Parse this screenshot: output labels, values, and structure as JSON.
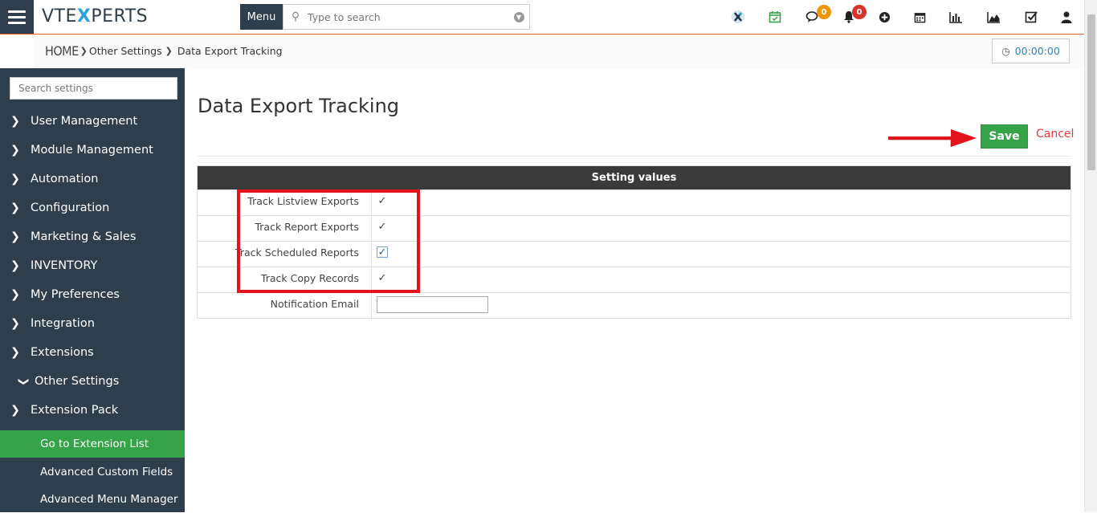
{
  "header": {
    "logo_prefix": "VTE",
    "logo_x": "X",
    "logo_suffix": "PERTS",
    "menu_label": "Menu",
    "search_placeholder": "Type to search",
    "chat_badge": "0",
    "notification_badge": "0",
    "colors": {
      "accent": "#e8663d",
      "chat_badge": "#f0960a",
      "notification_badge": "#d9342b"
    }
  },
  "breadcrumb": {
    "home": "HOME",
    "items": [
      "Other Settings",
      "Data Export Tracking"
    ]
  },
  "timer": {
    "value": "00:00:00"
  },
  "sidebar": {
    "search_placeholder": "Search settings",
    "items": [
      {
        "label": "User Management",
        "chevron": "right"
      },
      {
        "label": "Module Management",
        "chevron": "right"
      },
      {
        "label": "Automation",
        "chevron": "right"
      },
      {
        "label": "Configuration",
        "chevron": "right"
      },
      {
        "label": "Marketing & Sales",
        "chevron": "right"
      },
      {
        "label": "INVENTORY",
        "chevron": "right"
      },
      {
        "label": "My Preferences",
        "chevron": "right"
      },
      {
        "label": "Integration",
        "chevron": "right"
      },
      {
        "label": "Extensions",
        "chevron": "right"
      },
      {
        "label": "Other Settings",
        "chevron": "down"
      },
      {
        "label": "Extension Pack",
        "chevron": "right"
      }
    ],
    "sub_items": [
      {
        "label": "Go to Extension List",
        "active": true
      },
      {
        "label": "Advanced Custom Fields",
        "active": false
      },
      {
        "label": "Advanced Menu Manager",
        "active": false
      }
    ]
  },
  "main": {
    "title": "Data Export Tracking",
    "save_label": "Save",
    "cancel_label": "Cancel",
    "table_header": "Setting values",
    "rows": [
      {
        "label": "Track Listview Exports",
        "type": "checkbox",
        "checked": true
      },
      {
        "label": "Track Report Exports",
        "type": "checkbox",
        "checked": true
      },
      {
        "label": "Track Scheduled Reports",
        "type": "checkbox",
        "checked": true
      },
      {
        "label": "Track Copy Records",
        "type": "checkbox",
        "checked": true
      },
      {
        "label": "Notification Email",
        "type": "text",
        "value": ""
      }
    ]
  }
}
